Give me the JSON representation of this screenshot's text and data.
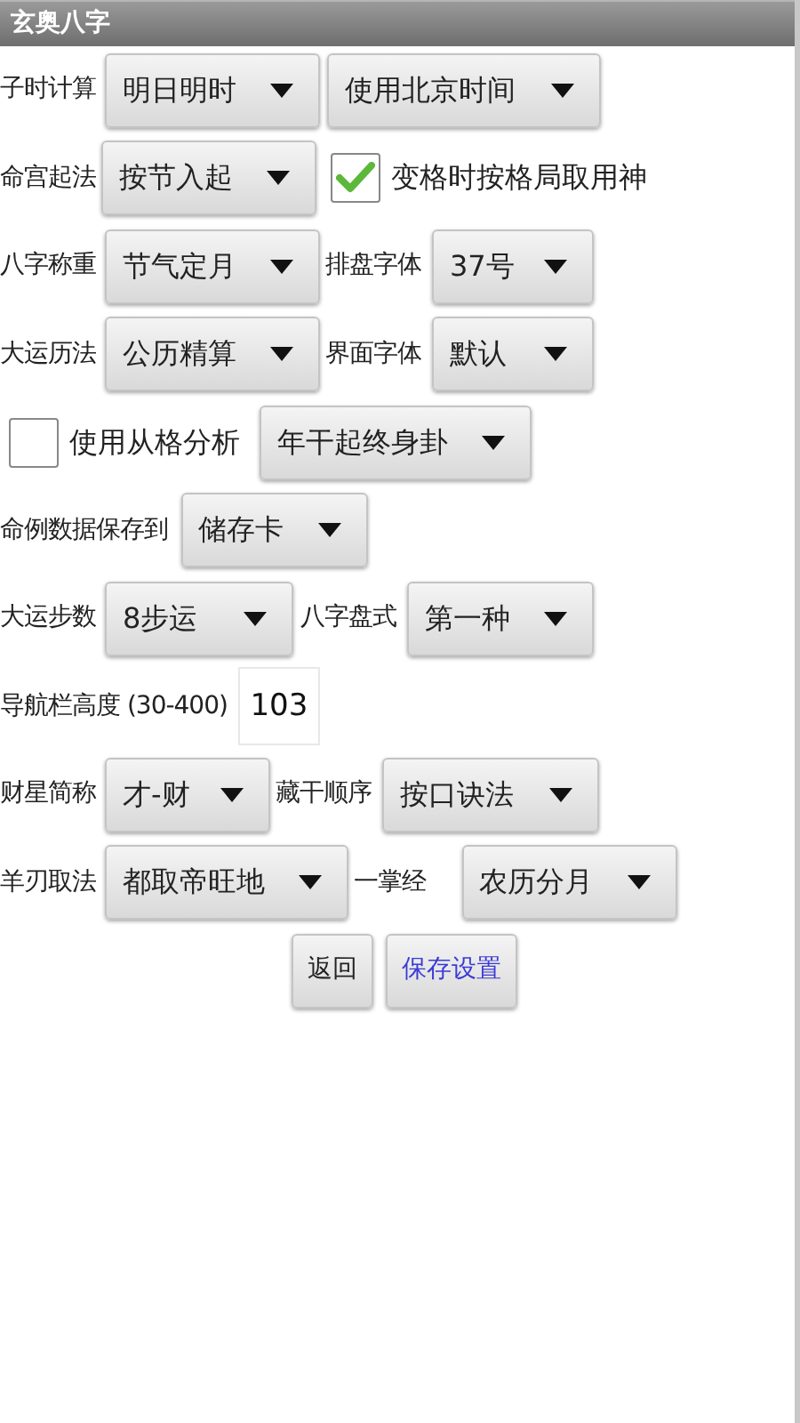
{
  "window": {
    "title": "玄奥八字"
  },
  "rows": [
    {
      "items": [
        {
          "kind": "label",
          "text": "子时计算"
        },
        {
          "kind": "dropdown",
          "value": "明日明时"
        },
        {
          "kind": "dropdown",
          "value": "使用北京时间"
        }
      ]
    },
    {
      "items": [
        {
          "kind": "label",
          "text": "命宫起法"
        },
        {
          "kind": "dropdown",
          "value": "按节入起"
        },
        {
          "kind": "checkbox",
          "checked": true,
          "label": "变格时按格局取用神"
        }
      ]
    },
    {
      "items": [
        {
          "kind": "label",
          "text": "八字称重"
        },
        {
          "kind": "dropdown",
          "value": "节气定月"
        },
        {
          "kind": "label",
          "text": "排盘字体"
        },
        {
          "kind": "dropdown",
          "value": "37号"
        }
      ]
    },
    {
      "items": [
        {
          "kind": "label",
          "text": "大运历法"
        },
        {
          "kind": "dropdown",
          "value": "公历精算"
        },
        {
          "kind": "label",
          "text": "界面字体"
        },
        {
          "kind": "dropdown",
          "value": "默认"
        }
      ]
    },
    {
      "items": [
        {
          "kind": "checkbox",
          "checked": false,
          "label": "使用从格分析"
        },
        {
          "kind": "dropdown",
          "value": "年干起终身卦"
        }
      ]
    },
    {
      "items": [
        {
          "kind": "label",
          "text": "命例数据保存到"
        },
        {
          "kind": "dropdown",
          "value": "储存卡"
        }
      ]
    },
    {
      "items": [
        {
          "kind": "label",
          "text": "大运步数"
        },
        {
          "kind": "dropdown",
          "value": "8步运"
        },
        {
          "kind": "label",
          "text": "八字盘式"
        },
        {
          "kind": "dropdown",
          "value": "第一种"
        }
      ]
    },
    {
      "items": [
        {
          "kind": "label",
          "text": "导航栏高度 (30-400)"
        },
        {
          "kind": "field",
          "value": "103"
        }
      ]
    },
    {
      "items": [
        {
          "kind": "label",
          "text": "财星简称"
        },
        {
          "kind": "dropdown",
          "value": "才-财"
        },
        {
          "kind": "label",
          "text": "藏干顺序"
        },
        {
          "kind": "dropdown",
          "value": "按口诀法"
        }
      ]
    },
    {
      "items": [
        {
          "kind": "label",
          "text": "羊刃取法"
        },
        {
          "kind": "dropdown",
          "value": "都取帝旺地"
        },
        {
          "kind": "label",
          "text": "一掌经"
        },
        {
          "kind": "dropdown",
          "value": "农历分月"
        }
      ]
    }
  ],
  "buttons": [
    {
      "label": "返回",
      "kind": "plain"
    },
    {
      "label": "保存设置",
      "kind": "primary"
    }
  ]
}
